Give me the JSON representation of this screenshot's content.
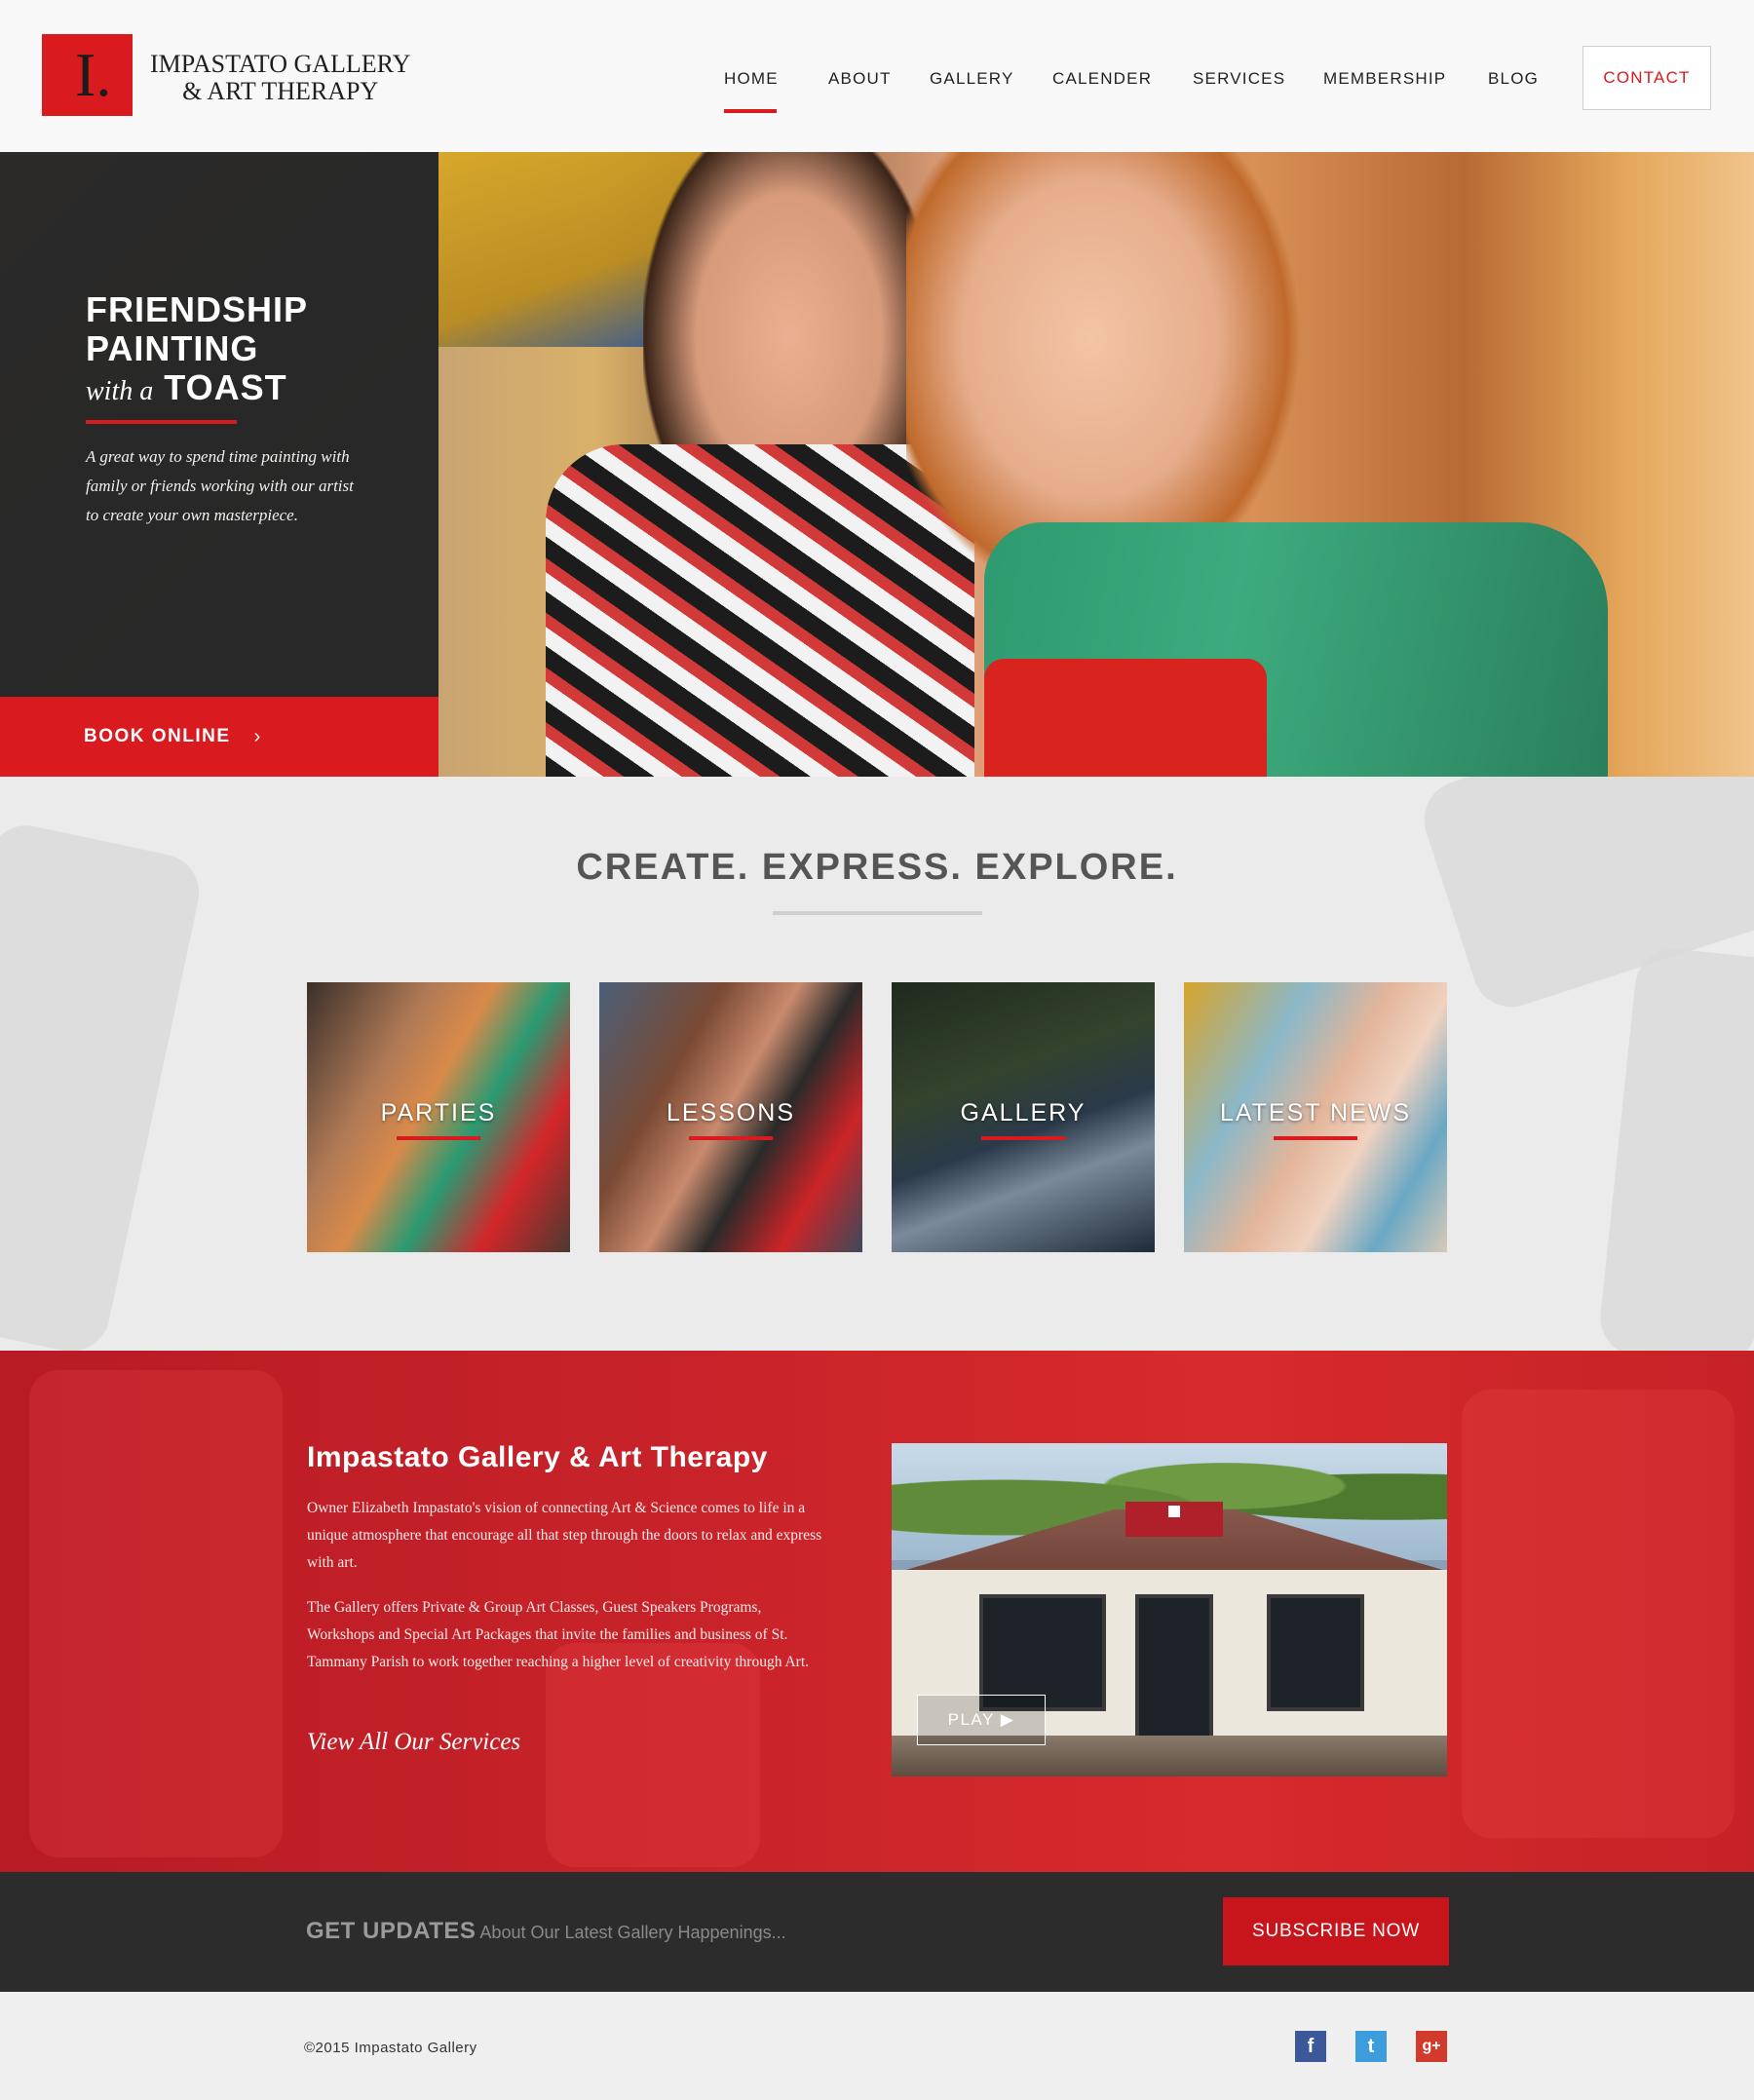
{
  "brand": {
    "logo_letter": "I.",
    "name_line1": "IMPASTATO GALLERY",
    "name_line2": "& ART THERAPY",
    "accent_color": "#d91a1f"
  },
  "nav": {
    "items": [
      {
        "label": "HOME",
        "active": true
      },
      {
        "label": "ABOUT"
      },
      {
        "label": "GALLERY"
      },
      {
        "label": "CALENDER"
      },
      {
        "label": "SERVICES"
      },
      {
        "label": "MEMBERSHIP"
      },
      {
        "label": "BLOG"
      }
    ],
    "contact_label": "CONTACT"
  },
  "hero": {
    "title_line1": "FRIENDSHIP",
    "title_line2": "PAINTING",
    "title_with": "with a",
    "title_toast": "TOAST",
    "description": "A great way to spend time painting with family or friends working with our artist to create your own masterpiece.",
    "book_label": "BOOK ONLINE",
    "book_icon": "chevron-right-icon"
  },
  "create": {
    "title": "CREATE. EXPRESS. EXPLORE.",
    "tiles": [
      {
        "label": "PARTIES"
      },
      {
        "label": "LESSONS"
      },
      {
        "label": "GALLERY"
      },
      {
        "label": "LATEST NEWS"
      }
    ]
  },
  "about": {
    "title": "Impastato Gallery & Art Therapy",
    "paragraph1": "Owner Elizabeth Impastato's vision of connecting Art & Science comes to life in a unique atmosphere that encourage all that step through the doors to relax and express with art.",
    "paragraph2": "The Gallery offers Private & Group Art Classes, Guest Speakers Programs, Workshops and Special Art Packages that invite the families and business of St. Tammany Parish to work together reaching a higher level of creativity through Art.",
    "link_label": "View All Our Services",
    "video_play_label": "PLAY ▶"
  },
  "updates": {
    "strong": "GET UPDATES",
    "text": "About Our Latest Gallery Happenings...",
    "subscribe_label": "SUBSCRIBE NOW"
  },
  "footer": {
    "copyright": "©2015 Impastato Gallery",
    "social": [
      {
        "icon": "facebook-icon",
        "glyph": "f",
        "color": "#3b5998"
      },
      {
        "icon": "twitter-icon",
        "glyph": "t",
        "color": "#3d9ddc"
      },
      {
        "icon": "google-plus-icon",
        "glyph": "g+",
        "color": "#d23a2c"
      }
    ]
  }
}
